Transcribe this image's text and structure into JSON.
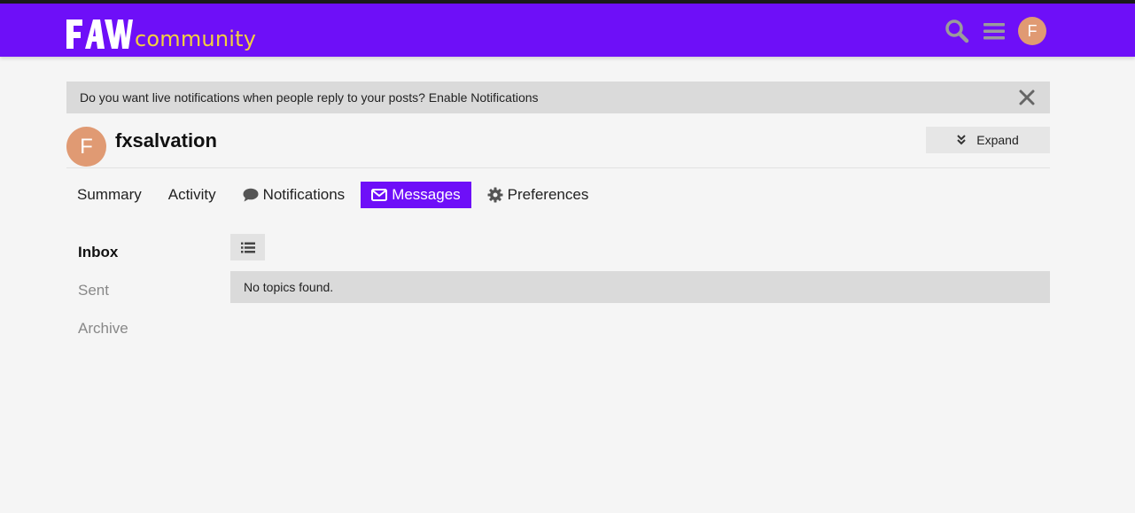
{
  "header": {
    "logo_text": "FAW",
    "logo_word": "community",
    "search_icon": "search-icon",
    "menu_icon": "hamburger-menu-icon",
    "avatar_letter": "F",
    "brand_color": "#6e0ff8",
    "accent_color": "#f3d03e"
  },
  "notice": {
    "text": "Do you want live notifications when people reply to your posts? Enable Notifications",
    "close_icon": "close-icon"
  },
  "user": {
    "avatar_letter": "F",
    "name": "fxsalvation",
    "expand_label": "Expand",
    "avatar_color": "#e09a73"
  },
  "tabs": [
    {
      "label": "Summary",
      "icon": null,
      "active": false
    },
    {
      "label": "Activity",
      "icon": null,
      "active": false
    },
    {
      "label": "Notifications",
      "icon": "comment-icon",
      "active": false
    },
    {
      "label": "Messages",
      "icon": "envelope-icon",
      "active": true
    },
    {
      "label": "Preferences",
      "icon": "gear-icon",
      "active": false
    }
  ],
  "sidenav": [
    {
      "label": "Inbox",
      "active": true
    },
    {
      "label": "Sent",
      "active": false
    },
    {
      "label": "Archive",
      "active": false
    }
  ],
  "messages": {
    "list_toggle_icon": "list-icon",
    "empty_text": "No topics found."
  }
}
